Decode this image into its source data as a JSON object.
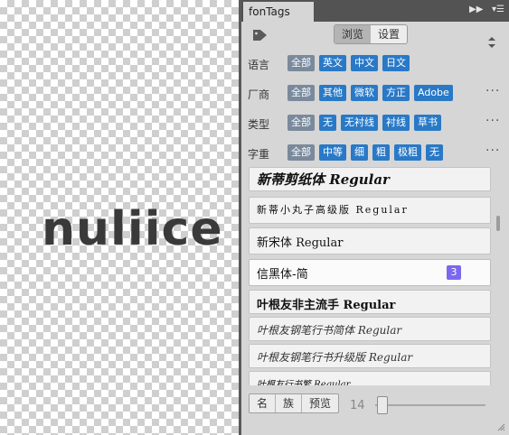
{
  "canvas": {
    "text": "nuliice"
  },
  "panel": {
    "tab_title": "fonTags",
    "collapse_icon": "double-chevron-right-icon",
    "menu_icon": "panel-menu-icon"
  },
  "header": {
    "tag_icon": "tag-icon",
    "seg_browse": "浏览",
    "seg_settings": "设置",
    "sort_icon": "sort-arrows-icon"
  },
  "filters": [
    {
      "label": "语言",
      "chips": [
        "全部",
        "英文",
        "中文",
        "日文"
      ],
      "more": ""
    },
    {
      "label": "厂商",
      "chips": [
        "全部",
        "其他",
        "微软",
        "方正",
        "Adobe"
      ],
      "more": "···"
    },
    {
      "label": "类型",
      "chips": [
        "全部",
        "无",
        "无衬线",
        "衬线",
        "草书"
      ],
      "more": "···"
    },
    {
      "label": "字重",
      "chips": [
        "全部",
        "中等",
        "细",
        "粗",
        "极粗",
        "无"
      ],
      "more": "···"
    }
  ],
  "fonts": [
    {
      "name": "新蒂剪纸体 Regular",
      "badge": ""
    },
    {
      "name": "新蒂小丸子高级版 Regular",
      "badge": ""
    },
    {
      "name": "新宋体 Regular",
      "badge": ""
    },
    {
      "name": "信黑体-简",
      "badge": "3"
    },
    {
      "name": "叶根友非主流手 Regular",
      "badge": ""
    },
    {
      "name": "叶根友钢笔行书简体 Regular",
      "badge": ""
    },
    {
      "name": "叶根友钢笔行书升级版 Regular",
      "badge": ""
    },
    {
      "name": "叶根友行书繁 Regular",
      "badge": ""
    }
  ],
  "footer": {
    "sort_name": "名",
    "sort_family": "族",
    "sort_preview": "预览",
    "size_value": "14",
    "size_fraction": 0.0
  },
  "colors": {
    "chip_blue": "#2979c7",
    "chip_all": "#7a8a9c",
    "badge_purple": "#7b68ee"
  }
}
